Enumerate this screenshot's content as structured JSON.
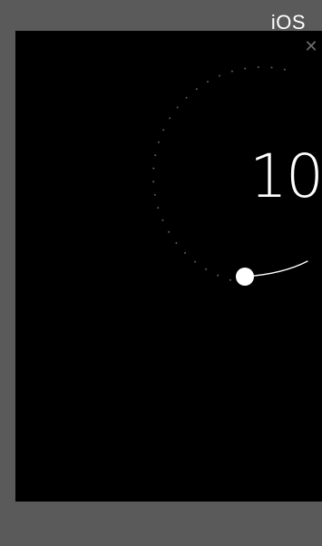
{
  "platform_label": "iOS",
  "close_icon": "close-icon",
  "timer": {
    "value": "10"
  },
  "colors": {
    "outer_frame": "#5a5a5a",
    "screen": "#000000",
    "text": "#ffffff",
    "dots": "#5f5f5f",
    "close": "#6d6d6d"
  }
}
